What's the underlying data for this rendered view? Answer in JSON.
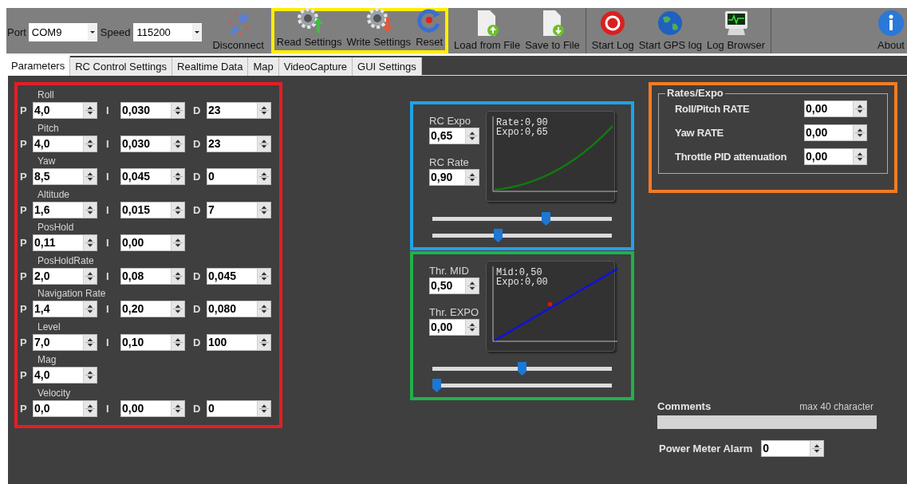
{
  "toolbar": {
    "port": {
      "label": "Port",
      "value": "COM9"
    },
    "speed": {
      "label": "Speed",
      "value": "115200"
    },
    "groups": [
      {
        "kind": "connect",
        "buttons": [
          {
            "kind": "disconnect",
            "label": "Disconnect"
          }
        ]
      },
      {
        "kind": "settings",
        "buttons": [
          {
            "kind": "read",
            "label": "Read Settings"
          },
          {
            "kind": "write",
            "label": "Write Settings"
          },
          {
            "kind": "reset",
            "label": "Reset"
          }
        ]
      },
      {
        "kind": "file",
        "buttons": [
          {
            "kind": "load",
            "label": "Load from File"
          },
          {
            "kind": "save",
            "label": "Save to File"
          }
        ]
      },
      {
        "kind": "log",
        "buttons": [
          {
            "kind": "log",
            "label": "Start Log"
          },
          {
            "kind": "gps",
            "label": "Start GPS log"
          },
          {
            "kind": "browser",
            "label": "Log Browser"
          }
        ]
      },
      {
        "kind": "about",
        "buttons": [
          {
            "kind": "about",
            "label": "About"
          }
        ]
      }
    ]
  },
  "tabs": [
    {
      "label": "Parameters",
      "selected": true
    },
    {
      "label": "RC Control Settings",
      "selected": false
    },
    {
      "label": "Realtime Data",
      "selected": false
    },
    {
      "label": "Map",
      "selected": false
    },
    {
      "label": "VideoCapture",
      "selected": false
    },
    {
      "label": "GUI Settings",
      "selected": false
    }
  ],
  "pid": [
    {
      "name": "Roll",
      "p": {
        "label": "P",
        "value": "4,0"
      },
      "i": {
        "label": "I",
        "value": "0,030"
      },
      "d": {
        "label": "D",
        "value": "23"
      }
    },
    {
      "name": "Pitch",
      "p": {
        "label": "P",
        "value": "4,0"
      },
      "i": {
        "label": "I",
        "value": "0,030"
      },
      "d": {
        "label": "D",
        "value": "23"
      }
    },
    {
      "name": "Yaw",
      "p": {
        "label": "P",
        "value": "8,5"
      },
      "i": {
        "label": "I",
        "value": "0,045"
      },
      "d": {
        "label": "D",
        "value": "0"
      }
    },
    {
      "name": "Altitude",
      "p": {
        "label": "P",
        "value": "1,6"
      },
      "i": {
        "label": "I",
        "value": "0,015"
      },
      "d": {
        "label": "D",
        "value": "7"
      }
    },
    {
      "name": "PosHold",
      "p": {
        "label": "P",
        "value": "0,11"
      },
      "i": {
        "label": "I",
        "value": "0,00"
      }
    },
    {
      "name": "PosHoldRate",
      "p": {
        "label": "P",
        "value": "2,0"
      },
      "i": {
        "label": "I",
        "value": "0,08"
      },
      "d": {
        "label": "D",
        "value": "0,045"
      }
    },
    {
      "name": "Navigation Rate",
      "p": {
        "label": "P",
        "value": "1,4"
      },
      "i": {
        "label": "I",
        "value": "0,20"
      },
      "d": {
        "label": "D",
        "value": "0,080"
      }
    },
    {
      "name": "Level",
      "p": {
        "label": "P",
        "value": "7,0"
      },
      "i": {
        "label": "I",
        "value": "0,10"
      },
      "d": {
        "label": "D",
        "value": "100"
      }
    },
    {
      "name": "Mag",
      "p": {
        "label": "P",
        "value": "4,0"
      }
    },
    {
      "name": "Velocity",
      "p": {
        "label": "P",
        "value": "0,0"
      },
      "i": {
        "label": "I",
        "value": "0,00"
      },
      "d": {
        "label": "D",
        "value": "0"
      }
    }
  ],
  "curves": [
    {
      "kind": "rc",
      "fields": [
        {
          "label": "RC Expo",
          "value": "0,65"
        },
        {
          "label": "RC Rate",
          "value": "0,90"
        }
      ],
      "readout": [
        "Rate:0,90",
        "Expo:0,65"
      ],
      "sliders": [
        {
          "level": 0.64
        },
        {
          "level": 0.36
        }
      ]
    },
    {
      "kind": "throttle",
      "fields": [
        {
          "label": "Thr. MID",
          "value": "0,50"
        },
        {
          "label": "Thr. EXPO",
          "value": "0,00"
        }
      ],
      "readout": [
        "Mid:0,50",
        "Expo:0,00"
      ],
      "sliders": [
        {
          "level": 0.5
        },
        {
          "level": 0.0
        }
      ]
    }
  ],
  "rates": {
    "title": "Rates/Expo",
    "rows": [
      {
        "label": "Roll/Pitch RATE",
        "value": "0,00"
      },
      {
        "label": "Yaw RATE",
        "value": "0,00"
      },
      {
        "label": "Throttle PID attenuation",
        "value": "0,00"
      }
    ]
  },
  "comments": {
    "label": "Comments",
    "hint": "max 40 character"
  },
  "power_alarm": {
    "label": "Power Meter Alarm",
    "value": "0"
  }
}
